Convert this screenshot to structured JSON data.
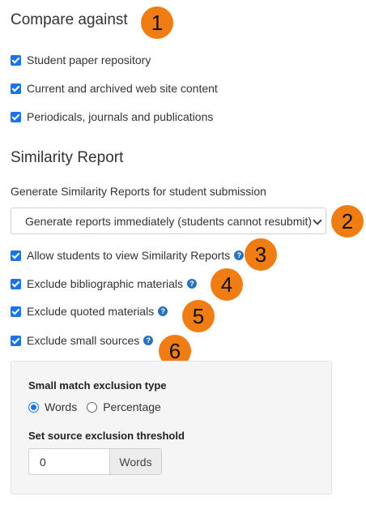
{
  "compare": {
    "heading": "Compare against",
    "options": [
      {
        "label": "Student paper repository",
        "checked": true
      },
      {
        "label": "Current and archived web site content",
        "checked": true
      },
      {
        "label": "Periodicals, journals and publications",
        "checked": true
      }
    ]
  },
  "similarity": {
    "heading": "Similarity Report",
    "generate_label": "Generate Similarity Reports for student submission",
    "generate_select_value": "Generate reports immediately (students cannot resubmit)",
    "options": [
      {
        "label": "Allow students to view Similarity Reports",
        "checked": true,
        "help": "?"
      },
      {
        "label": "Exclude bibliographic materials",
        "checked": true,
        "help": "?"
      },
      {
        "label": "Exclude quoted materials",
        "checked": true,
        "help": "?"
      },
      {
        "label": "Exclude small sources",
        "checked": true,
        "help": "?"
      }
    ]
  },
  "exclusion_panel": {
    "type_heading": "Small match exclusion type",
    "type_options": [
      {
        "label": "Words",
        "selected": true
      },
      {
        "label": "Percentage",
        "selected": false
      }
    ],
    "threshold_heading": "Set source exclusion threshold",
    "threshold_value": "0",
    "threshold_unit": "Words"
  },
  "callouts": [
    "1",
    "2",
    "3",
    "4",
    "5",
    "6"
  ],
  "colors": {
    "callout": "#f07c14",
    "checkbox": "#1a73e8",
    "help_icon": "#2a73b8",
    "panel_bg": "#f5f5f5"
  },
  "icons": {
    "help": "question-circle-icon",
    "select_arrow": "chevron-down-icon"
  }
}
